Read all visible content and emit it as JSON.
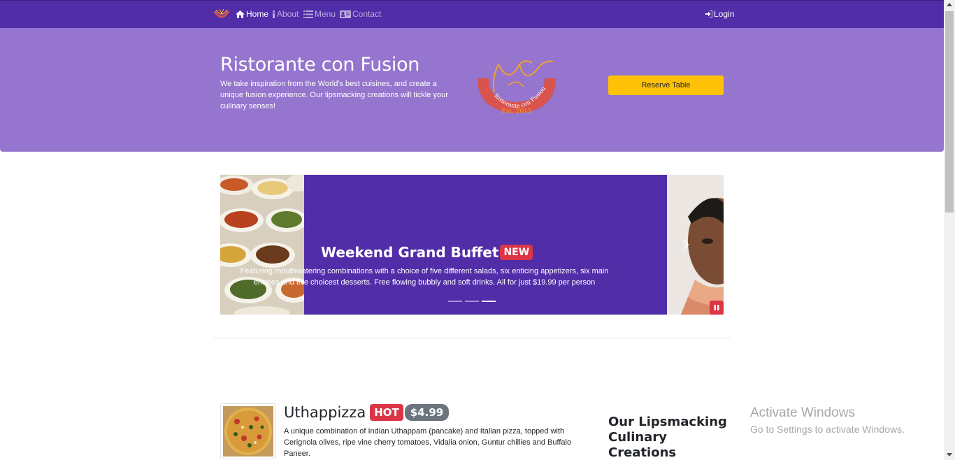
{
  "nav": {
    "home": "Home",
    "about": "About",
    "menu": "Menu",
    "contact": "Contact",
    "login": "Login",
    "brand_icon": "restaurant-logo-icon"
  },
  "jumbotron": {
    "title": "Ristorante con Fusion",
    "text": "We take inspiration from the World's best cuisines, and create a unique fusion experience. Our lipsmacking creations will tickle your culinary senses!",
    "logo_ring_text": "Ristorante con Fusion",
    "logo_est": "Est. 2013",
    "reserve_label": "Reserve Table"
  },
  "carousel": {
    "title": "Weekend Grand Buffet",
    "badge": "NEW",
    "text": "Featuring mouthwatering combinations with a choice of five different salads, six enticing appetizers, six main entrees and five choicest desserts. Free flowing bubbly and soft drinks. All for just $19.99 per person",
    "slide_count": 3,
    "active_slide": 3
  },
  "dish": {
    "name": "Uthappizza",
    "hot_badge": "HOT",
    "price": "$4.99",
    "description": "A unique combination of Indian Uthappam (pancake) and Italian pizza, topped with Cerignola olives, ripe vine cherry tomatoes, Vidalia onion, Guntur chillies and Buffalo Paneer."
  },
  "side": {
    "heading": "Our Lipsmacking Culinary Creations"
  },
  "watermark": {
    "title": "Activate Windows",
    "subtitle": "Go to Settings to activate Windows."
  },
  "colors": {
    "navbar": "#512da8",
    "jumbotron": "#9575cd",
    "reserve_button": "#ffc107",
    "badge_danger": "#dc3545",
    "badge_secondary": "#6c757d"
  }
}
